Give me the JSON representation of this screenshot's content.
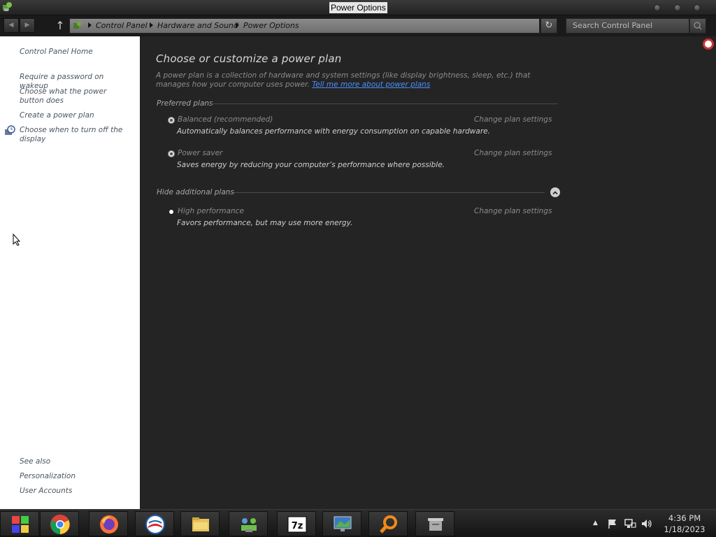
{
  "window": {
    "title": "Power Options"
  },
  "address_bar": {
    "breadcrumbs": [
      "Control Panel",
      "Hardware and Sound",
      "Power Options"
    ],
    "search_placeholder": "Search Control Panel"
  },
  "left_pane": {
    "home": "Control Panel Home",
    "links": [
      "Require a password on wakeup",
      "Choose what the power button does",
      "Create a power plan",
      "Choose when to turn off the display"
    ],
    "see_also_heading": "See also",
    "see_also": [
      "Personalization",
      "User Accounts"
    ]
  },
  "main": {
    "heading": "Choose or customize a power plan",
    "description": "A power plan is a collection of hardware and system settings (like display brightness, sleep, etc.) that manages how your computer uses power.",
    "learn_more_link": "Tell me more about power plans",
    "preferred_heading": "Preferred plans",
    "additional_heading": "Hide additional plans",
    "change_link": "Change plan settings",
    "plans": [
      {
        "name": "Balanced (recommended)",
        "description": "Automatically balances performance with energy consumption on capable hardware.",
        "selected": false
      },
      {
        "name": "Power saver",
        "description": "Saves energy by reducing your computer’s performance where possible.",
        "selected": false
      },
      {
        "name": "High performance",
        "description": "Favors performance, but may use more energy.",
        "selected": true
      }
    ]
  },
  "taskbar": {
    "apps": [
      "start-icon",
      "chrome-icon",
      "firefox-icon",
      "obama-logo-icon",
      "file-explorer-icon",
      "network-people-icon",
      "7zip-icon",
      "monitor-icon",
      "search-magnifier-icon",
      "archive-icon"
    ],
    "time": "4:36 PM",
    "date": "1/18/2023"
  }
}
